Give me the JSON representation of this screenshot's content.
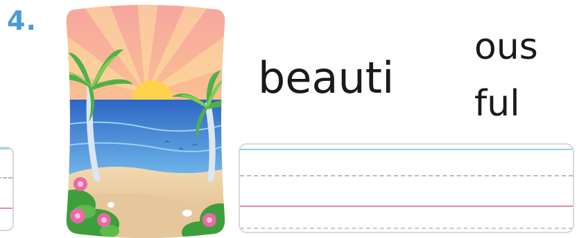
{
  "question": {
    "number": "4."
  },
  "picture": {
    "icon": "tropical-beach-sunset-picture"
  },
  "word_parts": {
    "start": "beauti",
    "option_a": "ous",
    "option_b": "ful"
  },
  "colors": {
    "number": "#4a9bd8",
    "guide_top": "#8fd0ee",
    "guide_mid": "#b8b8b8",
    "guide_base": "#e58aa8",
    "box_border": "#d9d9d9"
  }
}
